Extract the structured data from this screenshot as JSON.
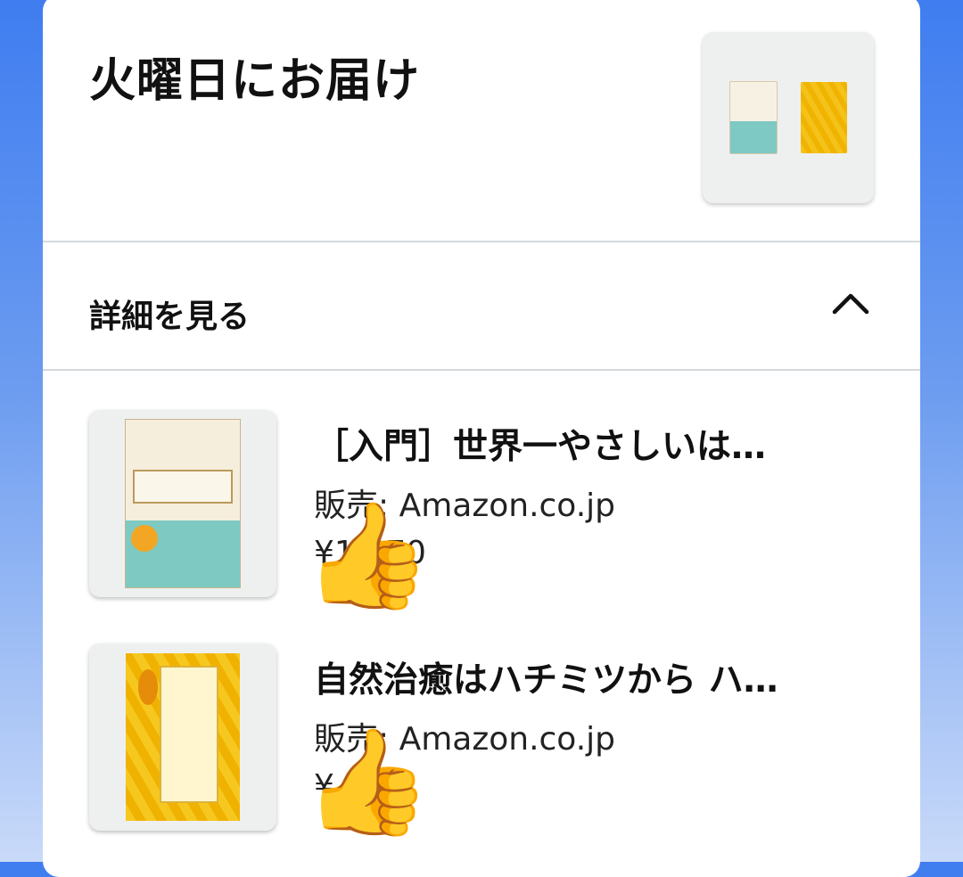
{
  "delivery": {
    "title": "火曜日にお届け"
  },
  "details": {
    "label": "詳細を見る"
  },
  "items": [
    {
      "title": "［入門］世界一やさしいは…",
      "seller": "販売: Amazon.co.jp",
      "price": "¥1,870"
    },
    {
      "title": "自然治癒はハチミツから ハ…",
      "seller": "販売: Amazon.co.jp",
      "price": "¥"
    }
  ],
  "overlay": {
    "emoji": "👍"
  }
}
